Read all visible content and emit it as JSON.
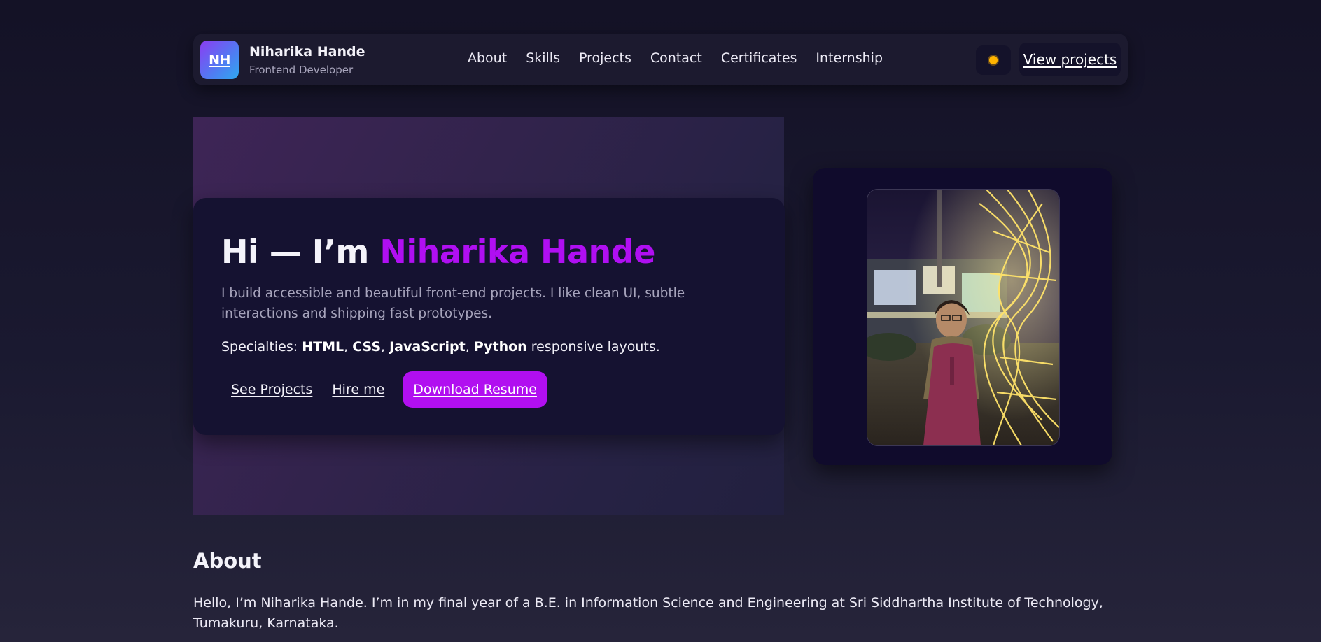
{
  "brand": {
    "logo_text": "NH",
    "name": "Niharika Hande",
    "role": "Frontend Developer"
  },
  "nav": {
    "items": [
      {
        "label": "About"
      },
      {
        "label": "Skills"
      },
      {
        "label": "Projects"
      },
      {
        "label": "Contact"
      },
      {
        "label": "Certificates"
      },
      {
        "label": "Internship"
      }
    ],
    "theme_icon": "sun-icon",
    "view_projects_label": "View projects"
  },
  "hero": {
    "greeting": "Hi — I’m ",
    "name": "Niharika Hande",
    "description": "I build accessible and beautiful front-end projects. I like clean UI, subtle interactions and shipping fast prototypes.",
    "specialties_prefix": "Specialties: ",
    "specialties": [
      "HTML",
      "CSS",
      "JavaScript",
      "Python"
    ],
    "specialties_suffix": " responsive layouts.",
    "actions": {
      "see_projects": "See Projects",
      "hire_me": "Hire me",
      "download_resume": "Download Resume"
    }
  },
  "about": {
    "title": "About",
    "text": "Hello, I’m Niharika Hande. I’m in my final year of a B.E. in Information Science and Engineering at Sri Siddhartha Institute of Technology, Tumakuru, Karnataka."
  },
  "colors": {
    "accent": "#b00ff2",
    "background": "#141226",
    "card": "#151231"
  }
}
